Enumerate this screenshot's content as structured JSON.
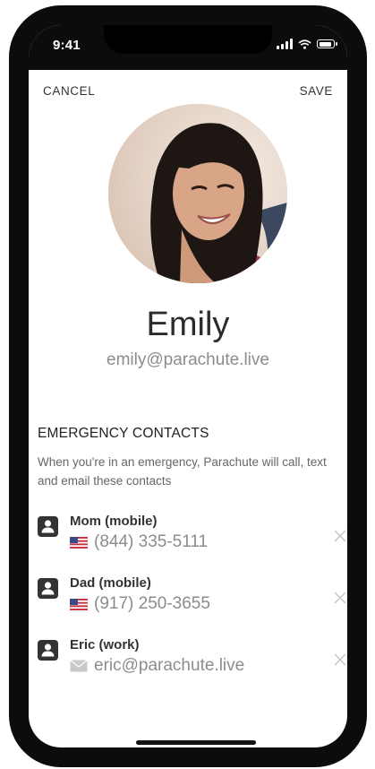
{
  "status_bar": {
    "time": "9:41"
  },
  "nav": {
    "cancel_label": "CANCEL",
    "save_label": "SAVE"
  },
  "profile": {
    "name": "Emily",
    "email": "emily@parachute.live"
  },
  "emergency": {
    "title": "EMERGENCY CONTACTS",
    "description": "When you're in an emergency, Parachute will call, text and email these contacts",
    "contacts": [
      {
        "name": "Mom (mobile)",
        "detail": "(844) 335-5111",
        "detail_icon": "us-flag-icon"
      },
      {
        "name": "Dad (mobile)",
        "detail": "(917) 250-3655",
        "detail_icon": "us-flag-icon"
      },
      {
        "name": "Eric (work)",
        "detail": "eric@parachute.live",
        "detail_icon": "mail-icon"
      }
    ]
  }
}
